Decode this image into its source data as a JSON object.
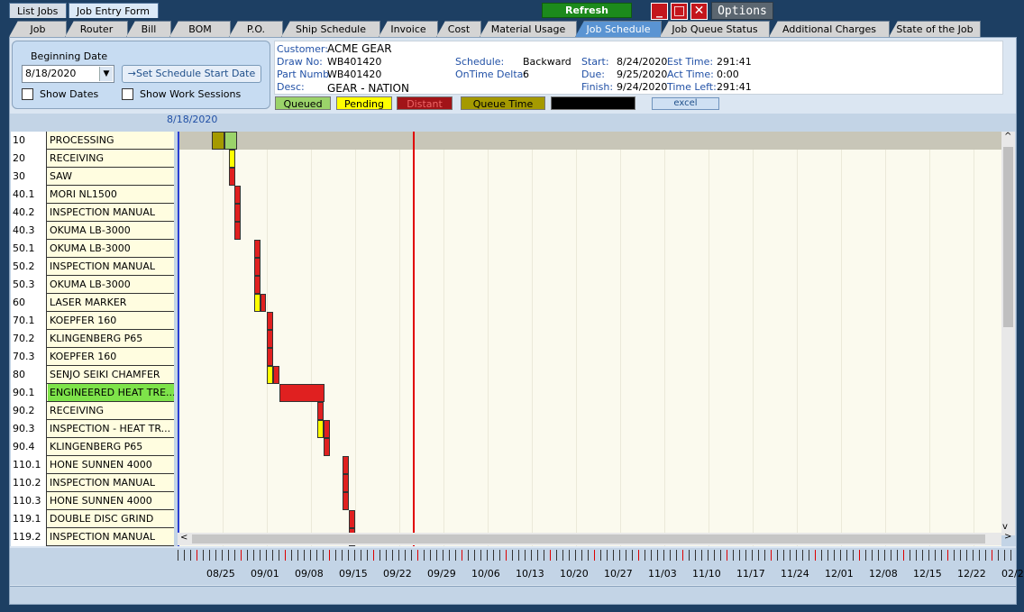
{
  "top_tabs": {
    "list_jobs": "List Jobs",
    "job_entry_form": "Job Entry Form"
  },
  "toolbar": {
    "refresh": "Refresh",
    "options": "Options"
  },
  "tabs": [
    "Job",
    "Router",
    "Bill",
    "BOM",
    "P.O.",
    "Ship Schedule",
    "Invoice",
    "Cost",
    "Material Usage",
    "Job Schedule",
    "Job Queue Status",
    "Additional Charges",
    "State of the Job"
  ],
  "active_tab": "Job Schedule",
  "schedule_box": {
    "title": "Beginning Date",
    "date_value": "8/18/2020",
    "set_button": "→Set Schedule Start Date",
    "show_dates": "Show Dates",
    "show_work_sessions": "Show Work Sessions"
  },
  "info": {
    "customer_label": "Customer:",
    "customer": "ACME GEAR",
    "draw_label": "Draw No:",
    "draw": "WB401420",
    "part_label": "Part Numb",
    "part": "WB401420",
    "desc_label": "Desc:",
    "desc": "GEAR - NATION",
    "schedule_label": "Schedule:",
    "schedule": "Backward",
    "ontime_label": "OnTime Delta:",
    "ontime": "6",
    "start_label": "Start:",
    "start": "8/24/2020",
    "due_label": "Due:",
    "due": "9/25/2020",
    "finish_label": "Finish:",
    "finish": "9/24/2020",
    "est_label": "Est Time:",
    "est": "291:41",
    "act_label": "Act Time:",
    "act": "0:00",
    "left_label": "Time Left:",
    "left": "291:41"
  },
  "legend": {
    "queued": "Queued",
    "pending": "Pending",
    "distant": "Distant",
    "queue_time": "Queue Time",
    "excel": "excel"
  },
  "colors": {
    "queued": "#9bd36a",
    "pending": "#ffff00",
    "distant": "#a11418",
    "queue_time": "#a59a00",
    "bar_red": "#e02020",
    "today_line": "#e00000"
  },
  "gantt": {
    "start_date_label": "8/18/2020",
    "rows": [
      {
        "op": "10",
        "name": "PROCESSING"
      },
      {
        "op": "20",
        "name": "RECEIVING"
      },
      {
        "op": "30",
        "name": "SAW"
      },
      {
        "op": "40.1",
        "name": "MORI NL1500"
      },
      {
        "op": "40.2",
        "name": "INSPECTION MANUAL"
      },
      {
        "op": "40.3",
        "name": "OKUMA LB-3000"
      },
      {
        "op": "50.1",
        "name": "OKUMA LB-3000"
      },
      {
        "op": "50.2",
        "name": "INSPECTION MANUAL"
      },
      {
        "op": "50.3",
        "name": "OKUMA LB-3000"
      },
      {
        "op": "60",
        "name": "LASER MARKER"
      },
      {
        "op": "70.1",
        "name": "KOEPFER 160"
      },
      {
        "op": "70.2",
        "name": "KLINGENBERG P65"
      },
      {
        "op": "70.3",
        "name": "KOEPFER 160"
      },
      {
        "op": "80",
        "name": "SENJO SEIKI CHAMFER"
      },
      {
        "op": "90.1",
        "name": "ENGINEERED  HEAT  TRE..."
      },
      {
        "op": "90.2",
        "name": "RECEIVING"
      },
      {
        "op": "90.3",
        "name": "INSPECTION  -  HEAT  TR..."
      },
      {
        "op": "90.4",
        "name": "KLINGENBERG P65"
      },
      {
        "op": "110.1",
        "name": "HONE SUNNEN 4000"
      },
      {
        "op": "110.2",
        "name": "INSPECTION MANUAL"
      },
      {
        "op": "110.3",
        "name": "HONE SUNNEN 4000"
      },
      {
        "op": "119.1",
        "name": "DOUBLE DISC GRIND"
      },
      {
        "op": "119.2",
        "name": "INSPECTION MANUAL"
      }
    ],
    "timeline_labels": [
      "08/25",
      "09/01",
      "09/08",
      "09/15",
      "09/22",
      "09/29",
      "10/06",
      "10/13",
      "10/20",
      "10/27",
      "11/03",
      "11/10",
      "11/17",
      "11/24",
      "12/01",
      "12/08",
      "12/15",
      "12/22",
      "02/2"
    ]
  }
}
